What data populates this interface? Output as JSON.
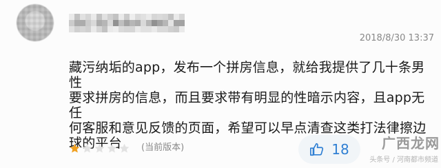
{
  "review": {
    "timestamp": "2018/8/30 13:37",
    "text": "藏污纳垢的app，发布一个拼房信息，就给我提供了几十条男性\n要求拼房的信息，而且要求带有明显的性暗示内容，且app无任\n何客服和意见反馈的页面，希望可以早点清查这类打法律擦边\n球的平台",
    "rating": 1,
    "max_rating": 5,
    "version_label": "(当前版本)",
    "like_count": "18",
    "like_icon": "thumbs-up-icon",
    "avatar_icon": "avatar-icon",
    "star_icon": "star-icon"
  },
  "watermark": {
    "logo_text": "广西龙网",
    "logo_sub": "头条号 / 河南都市频道"
  },
  "colors": {
    "accent": "#2f7fd3",
    "star_active": "#f0a020",
    "star_inactive": "#e2e2e2",
    "text": "#1a1a1a",
    "meta": "#888888",
    "like_bg": "#f1f5f8"
  }
}
